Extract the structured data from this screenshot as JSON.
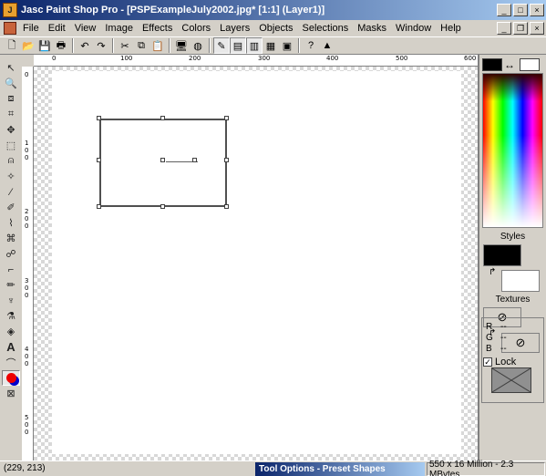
{
  "window": {
    "title": "Jasc Paint Shop Pro - [PSPExampleJuly2002.jpg* [1:1] (Layer1)]",
    "app_icon": "paintshop-icon",
    "controls": {
      "minimize": "_",
      "maximize": "□",
      "close": "×"
    }
  },
  "menubar": {
    "items": [
      "File",
      "Edit",
      "View",
      "Image",
      "Effects",
      "Colors",
      "Layers",
      "Objects",
      "Selections",
      "Masks",
      "Window",
      "Help"
    ],
    "doc_controls": {
      "minimize": "_",
      "restore": "❐",
      "close": "×"
    }
  },
  "toolbar": {
    "buttons": [
      "new-icon",
      "open-icon",
      "save-icon",
      "print-icon",
      "undo-icon",
      "redo-icon",
      "cut-icon",
      "copy-icon",
      "paste-icon",
      "browse-icon",
      "screen-icon",
      "color-icon",
      "toolbox-icon",
      "layers-icon",
      "overview-icon",
      "histogram-icon",
      "help-icon",
      "capture-icon"
    ]
  },
  "tools": [
    "arrow-tool",
    "zoom-tool",
    "deform-tool",
    "crop-tool",
    "move-tool",
    "selection-tool",
    "freehand-tool",
    "magic-wand-tool",
    "dropper-tool",
    "paintbrush-tool",
    "clone-tool",
    "color-replacer-tool",
    "retouch-tool",
    "scratch-remover-tool",
    "eraser-tool",
    "picture-tube-tool",
    "airbrush-tool",
    "flood-fill-tool",
    "text-tool",
    "draw-tool",
    "preset-shapes-tool",
    "object-selector-tool"
  ],
  "rulers": {
    "top": [
      "0",
      "100",
      "200",
      "300",
      "400",
      "500",
      "600"
    ],
    "left": [
      "0",
      "1 0 0",
      "2 0 0",
      "3 0 0",
      "4 0 0",
      "5 0 0"
    ]
  },
  "panel": {
    "styles_label": "Styles",
    "textures_label": "Textures",
    "lock_label": "Lock",
    "lock_checked": true,
    "r_label": "R",
    "r_value": "--",
    "g_label": "G",
    "g_value": "--",
    "b_label": "B",
    "b_value": "--",
    "foreground_color": "#000000",
    "background_color": "#ffffff"
  },
  "status": {
    "coords": "(229, 213)",
    "tool_options": "Tool Options - Preset Shapes",
    "image_info": "550 x 16 Million - 2.3 MBytes"
  }
}
